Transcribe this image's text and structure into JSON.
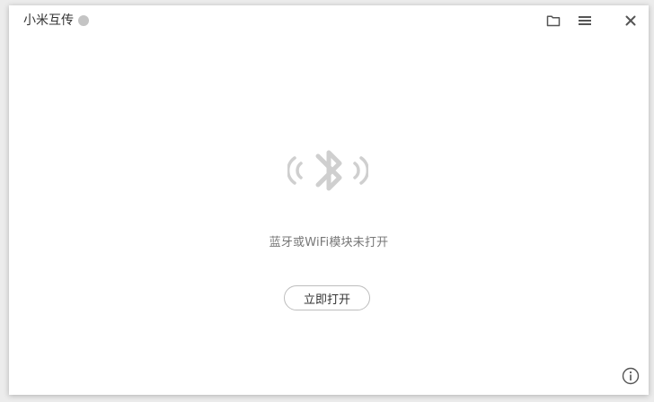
{
  "app": {
    "title": "小米互传",
    "status_dot_color": "#c4c4c4"
  },
  "toolbar": {
    "folder_icon": "folder-icon",
    "menu_icon": "hamburger-menu-icon",
    "close_icon": "close-icon"
  },
  "main": {
    "graphic_icon": "bluetooth-wireless-icon",
    "status_text": "蓝牙或WiFi模块未打开",
    "open_button_label": "立即打开"
  },
  "footer": {
    "info_icon": "info-icon"
  }
}
